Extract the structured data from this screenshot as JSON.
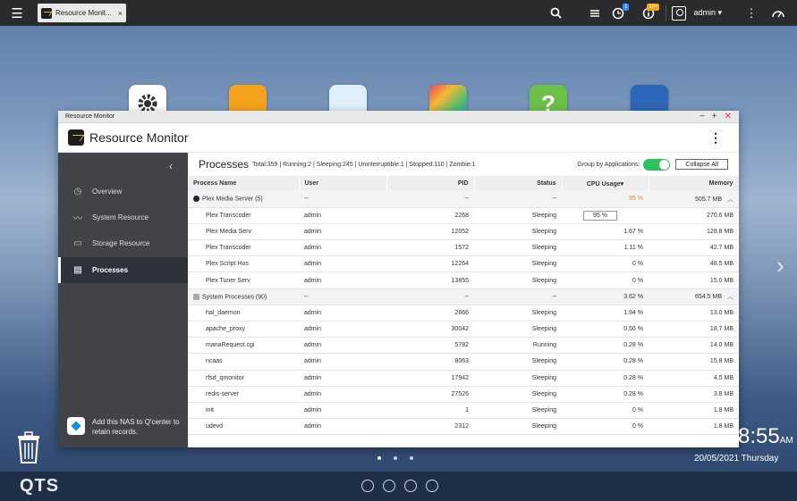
{
  "taskbar": {
    "tab_label": "Resource Monit...",
    "tab_close": "×",
    "notification_badge": "1",
    "info_badge": "10+",
    "user_name": "admin ▾"
  },
  "window": {
    "title": "Resource Monitor",
    "app_title": "Resource Monitor"
  },
  "sidebar": {
    "items": [
      {
        "label": "Overview",
        "icon": "clock-icon"
      },
      {
        "label": "System Resource",
        "icon": "chart-icon"
      },
      {
        "label": "Storage Resource",
        "icon": "storage-icon"
      },
      {
        "label": "Processes",
        "icon": "list-icon"
      }
    ],
    "qcenter_text": "Add this NAS to Q'center to retain records."
  },
  "processes": {
    "title": "Processes",
    "summary": "Total:359 | Running:2 | Sleeping:245 | Uninterruptible:1 | Stopped:110 | Zombie:1",
    "group_label": "Group by Applications:",
    "collapse_label": "Collapse All",
    "columns": [
      "Process Name",
      "User",
      "PID",
      "Status",
      "CPU Usage▾",
      "Memory"
    ],
    "groups": [
      {
        "name": "Plex Media Server (5)",
        "user": "--",
        "pid": "--",
        "status": "--",
        "cpu": "95 %",
        "memory": "505.7 MB",
        "rows": [
          {
            "name": "Plex Transcoder",
            "user": "admin",
            "pid": "2268",
            "status": "Sleeping",
            "cpu": "95 %",
            "memory": "270.6 MB"
          },
          {
            "name": "Plex Media Serv",
            "user": "admin",
            "pid": "12052",
            "status": "Sleeping",
            "cpu": "1.67 %",
            "memory": "128.8 MB"
          },
          {
            "name": "Plex Transcoder",
            "user": "admin",
            "pid": "1572",
            "status": "Sleeping",
            "cpu": "1.11 %",
            "memory": "42.7 MB"
          },
          {
            "name": "Plex Script Hos",
            "user": "admin",
            "pid": "12264",
            "status": "Sleeping",
            "cpu": "0 %",
            "memory": "48.5 MB"
          },
          {
            "name": "Plex Tuner Serv",
            "user": "admin",
            "pid": "13855",
            "status": "Sleeping",
            "cpu": "0 %",
            "memory": "15.0 MB"
          }
        ]
      },
      {
        "name": "System Processes (90)",
        "user": "--",
        "pid": "--",
        "status": "--",
        "cpu": "3.62 %",
        "memory": "654.5 MB",
        "rows": [
          {
            "name": "hal_daemon",
            "user": "admin",
            "pid": "2866",
            "status": "Sleeping",
            "cpu": "1.94 %",
            "memory": "13.0 MB"
          },
          {
            "name": "apache_proxy",
            "user": "admin",
            "pid": "30042",
            "status": "Sleeping",
            "cpu": "0.56 %",
            "memory": "18.7 MB"
          },
          {
            "name": "manaRequest.cgi",
            "user": "admin",
            "pid": "5782",
            "status": "Running",
            "cpu": "0.28 %",
            "memory": "14.0 MB"
          },
          {
            "name": "ncaas",
            "user": "admin",
            "pid": "8063",
            "status": "Sleeping",
            "cpu": "0.28 %",
            "memory": "15.8 MB"
          },
          {
            "name": "rfsd_qmonitor",
            "user": "admin",
            "pid": "17942",
            "status": "Sleeping",
            "cpu": "0.28 %",
            "memory": "4.5 MB"
          },
          {
            "name": "redis-server",
            "user": "admin",
            "pid": "27526",
            "status": "Sleeping",
            "cpu": "0.28 %",
            "memory": "3.8 MB"
          },
          {
            "name": "init",
            "user": "admin",
            "pid": "1",
            "status": "Sleeping",
            "cpu": "0 %",
            "memory": "1.8 MB"
          },
          {
            "name": "udevd",
            "user": "admin",
            "pid": "2312",
            "status": "Sleeping",
            "cpu": "0 %",
            "memory": "1.8 MB"
          }
        ]
      }
    ]
  },
  "desktop": {
    "time": "8:55",
    "ampm": "AM",
    "date": "20/05/2021 Thursday",
    "logo": "QTS"
  },
  "colors": {
    "accent_green": "#2bc35a",
    "cpu_high": "#e88d16",
    "sidebar_bg": "#414349"
  }
}
